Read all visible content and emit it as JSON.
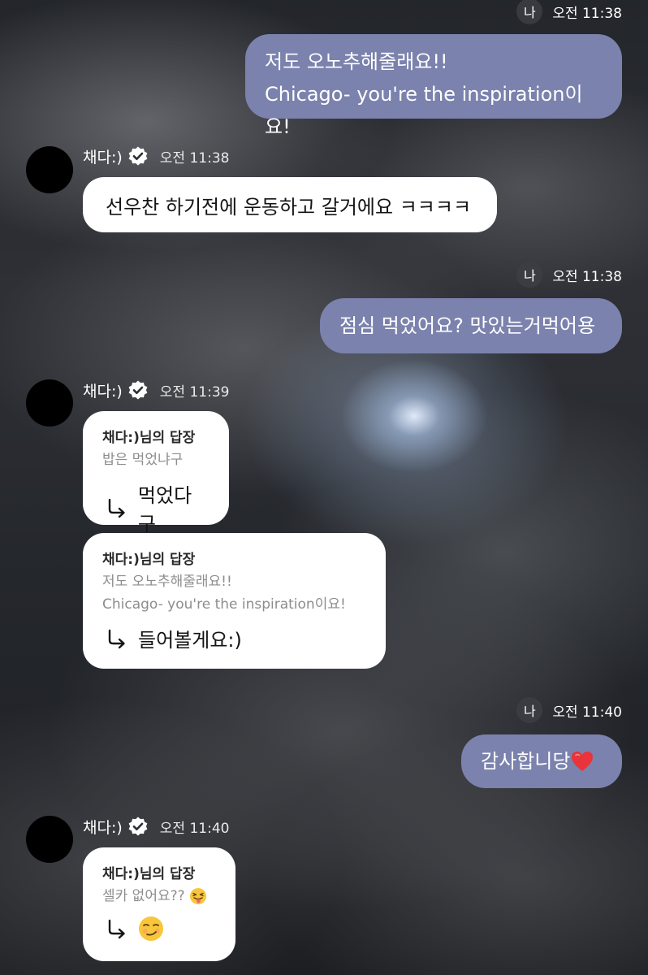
{
  "messages": [
    {
      "id": "m1",
      "type": "me",
      "sender_label": "나",
      "time": "오전 11:38",
      "lines": [
        "저도 오노추해줄래요!!",
        "Chicago- you're the inspiration이요!"
      ]
    },
    {
      "id": "m2",
      "type": "them",
      "sender": "채다:)",
      "time": "오전 11:38",
      "text": "선우찬 하기전에 운동하고 갈거에요 ㅋㅋㅋㅋ"
    },
    {
      "id": "m3",
      "type": "me",
      "sender_label": "나",
      "time": "오전 11:38",
      "text": "점심 먹었어요? 맛있는거먹어용"
    },
    {
      "id": "m4",
      "type": "them",
      "sender": "채다:)",
      "time": "오전 11:39",
      "replies": [
        {
          "head": "채다:)님의 답장",
          "quote_lines": [
            "밥은 먹었냐구"
          ],
          "answer": "먹었다구"
        },
        {
          "head": "채다:)님의 답장",
          "quote_lines": [
            "저도 오노추해줄래요!!",
            "Chicago- you're the inspiration이요!"
          ],
          "answer": "들어볼게요:)"
        }
      ]
    },
    {
      "id": "m5",
      "type": "me",
      "sender_label": "나",
      "time": "오전 11:40",
      "text": "감사합니당",
      "emoji": "red-heart"
    },
    {
      "id": "m6",
      "type": "them",
      "sender": "채다:)",
      "time": "오전 11:40",
      "reply": {
        "head": "채다:)님의 답장",
        "quote": "셀카 없어요??",
        "quote_emoji": "tongue-out-face",
        "answer_emoji": "smirking-face"
      }
    }
  ],
  "icons": {
    "verified": "verified-check-icon",
    "reply_arrow": "reply-arrow-icon"
  },
  "colors": {
    "my_bubble": "#7b82ad",
    "their_bubble": "#ffffff",
    "avatar": "#000000"
  }
}
